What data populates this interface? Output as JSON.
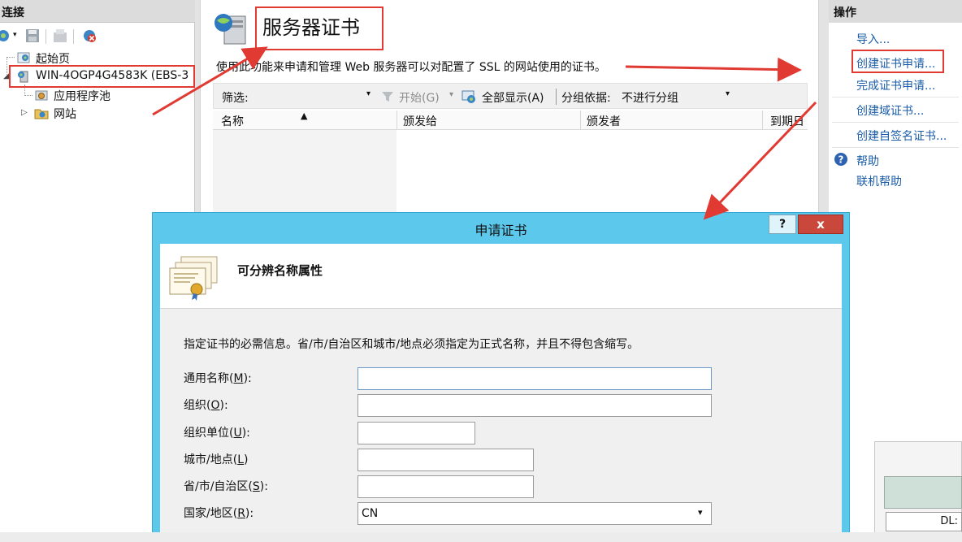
{
  "connections": {
    "header": "连接",
    "tree": [
      {
        "label": "起始页"
      },
      {
        "label": "WIN-4OGP4G4583K (EBS-3"
      },
      {
        "label": "应用程序池"
      },
      {
        "label": "网站"
      }
    ]
  },
  "main": {
    "title": "服务器证书",
    "description": "使用此功能来申请和管理 Web 服务器可以对配置了 SSL 的网站使用的证书。",
    "filter_label": "筛选:",
    "filter_value": "",
    "start_label": "开始(G)",
    "show_all_label": "全部显示(A)",
    "group_by_label": "分组依据:",
    "group_by_value": "不进行分组",
    "columns": [
      "名称",
      "颁发给",
      "颁发者",
      "到期日"
    ]
  },
  "actions": {
    "header": "操作",
    "items": [
      {
        "label": "导入..."
      },
      {
        "label": "创建证书申请..."
      },
      {
        "label": "完成证书申请..."
      },
      {
        "label": "创建域证书..."
      },
      {
        "label": "创建自签名证书..."
      },
      {
        "label": "帮助"
      },
      {
        "label": "联机帮助"
      }
    ]
  },
  "dialog": {
    "title": "申请证书",
    "help": "?",
    "close": "x",
    "heading": "可分辨名称属性",
    "instructions": "指定证书的必需信息。省/市/自治区和城市/地点必须指定为正式名称，并且不得包含缩写。",
    "fields": [
      {
        "label_main": "通用名称(",
        "label_key": "M",
        "label_tail": "):",
        "value": ""
      },
      {
        "label_main": "组织(",
        "label_key": "O",
        "label_tail": "):",
        "value": ""
      },
      {
        "label_main": "组织单位(",
        "label_key": "U",
        "label_tail": "):",
        "value": ""
      },
      {
        "label_main": "城市/地点(",
        "label_key": "L",
        "label_tail": ")",
        "value": ""
      },
      {
        "label_main": "省/市/自治区(",
        "label_key": "S",
        "label_tail": "):",
        "value": ""
      },
      {
        "label_main": "国家/地区(",
        "label_key": "R",
        "label_tail": "):",
        "value": "CN"
      }
    ]
  },
  "background_window": {
    "status": "DL:"
  },
  "annotation_color": "#e03a33"
}
